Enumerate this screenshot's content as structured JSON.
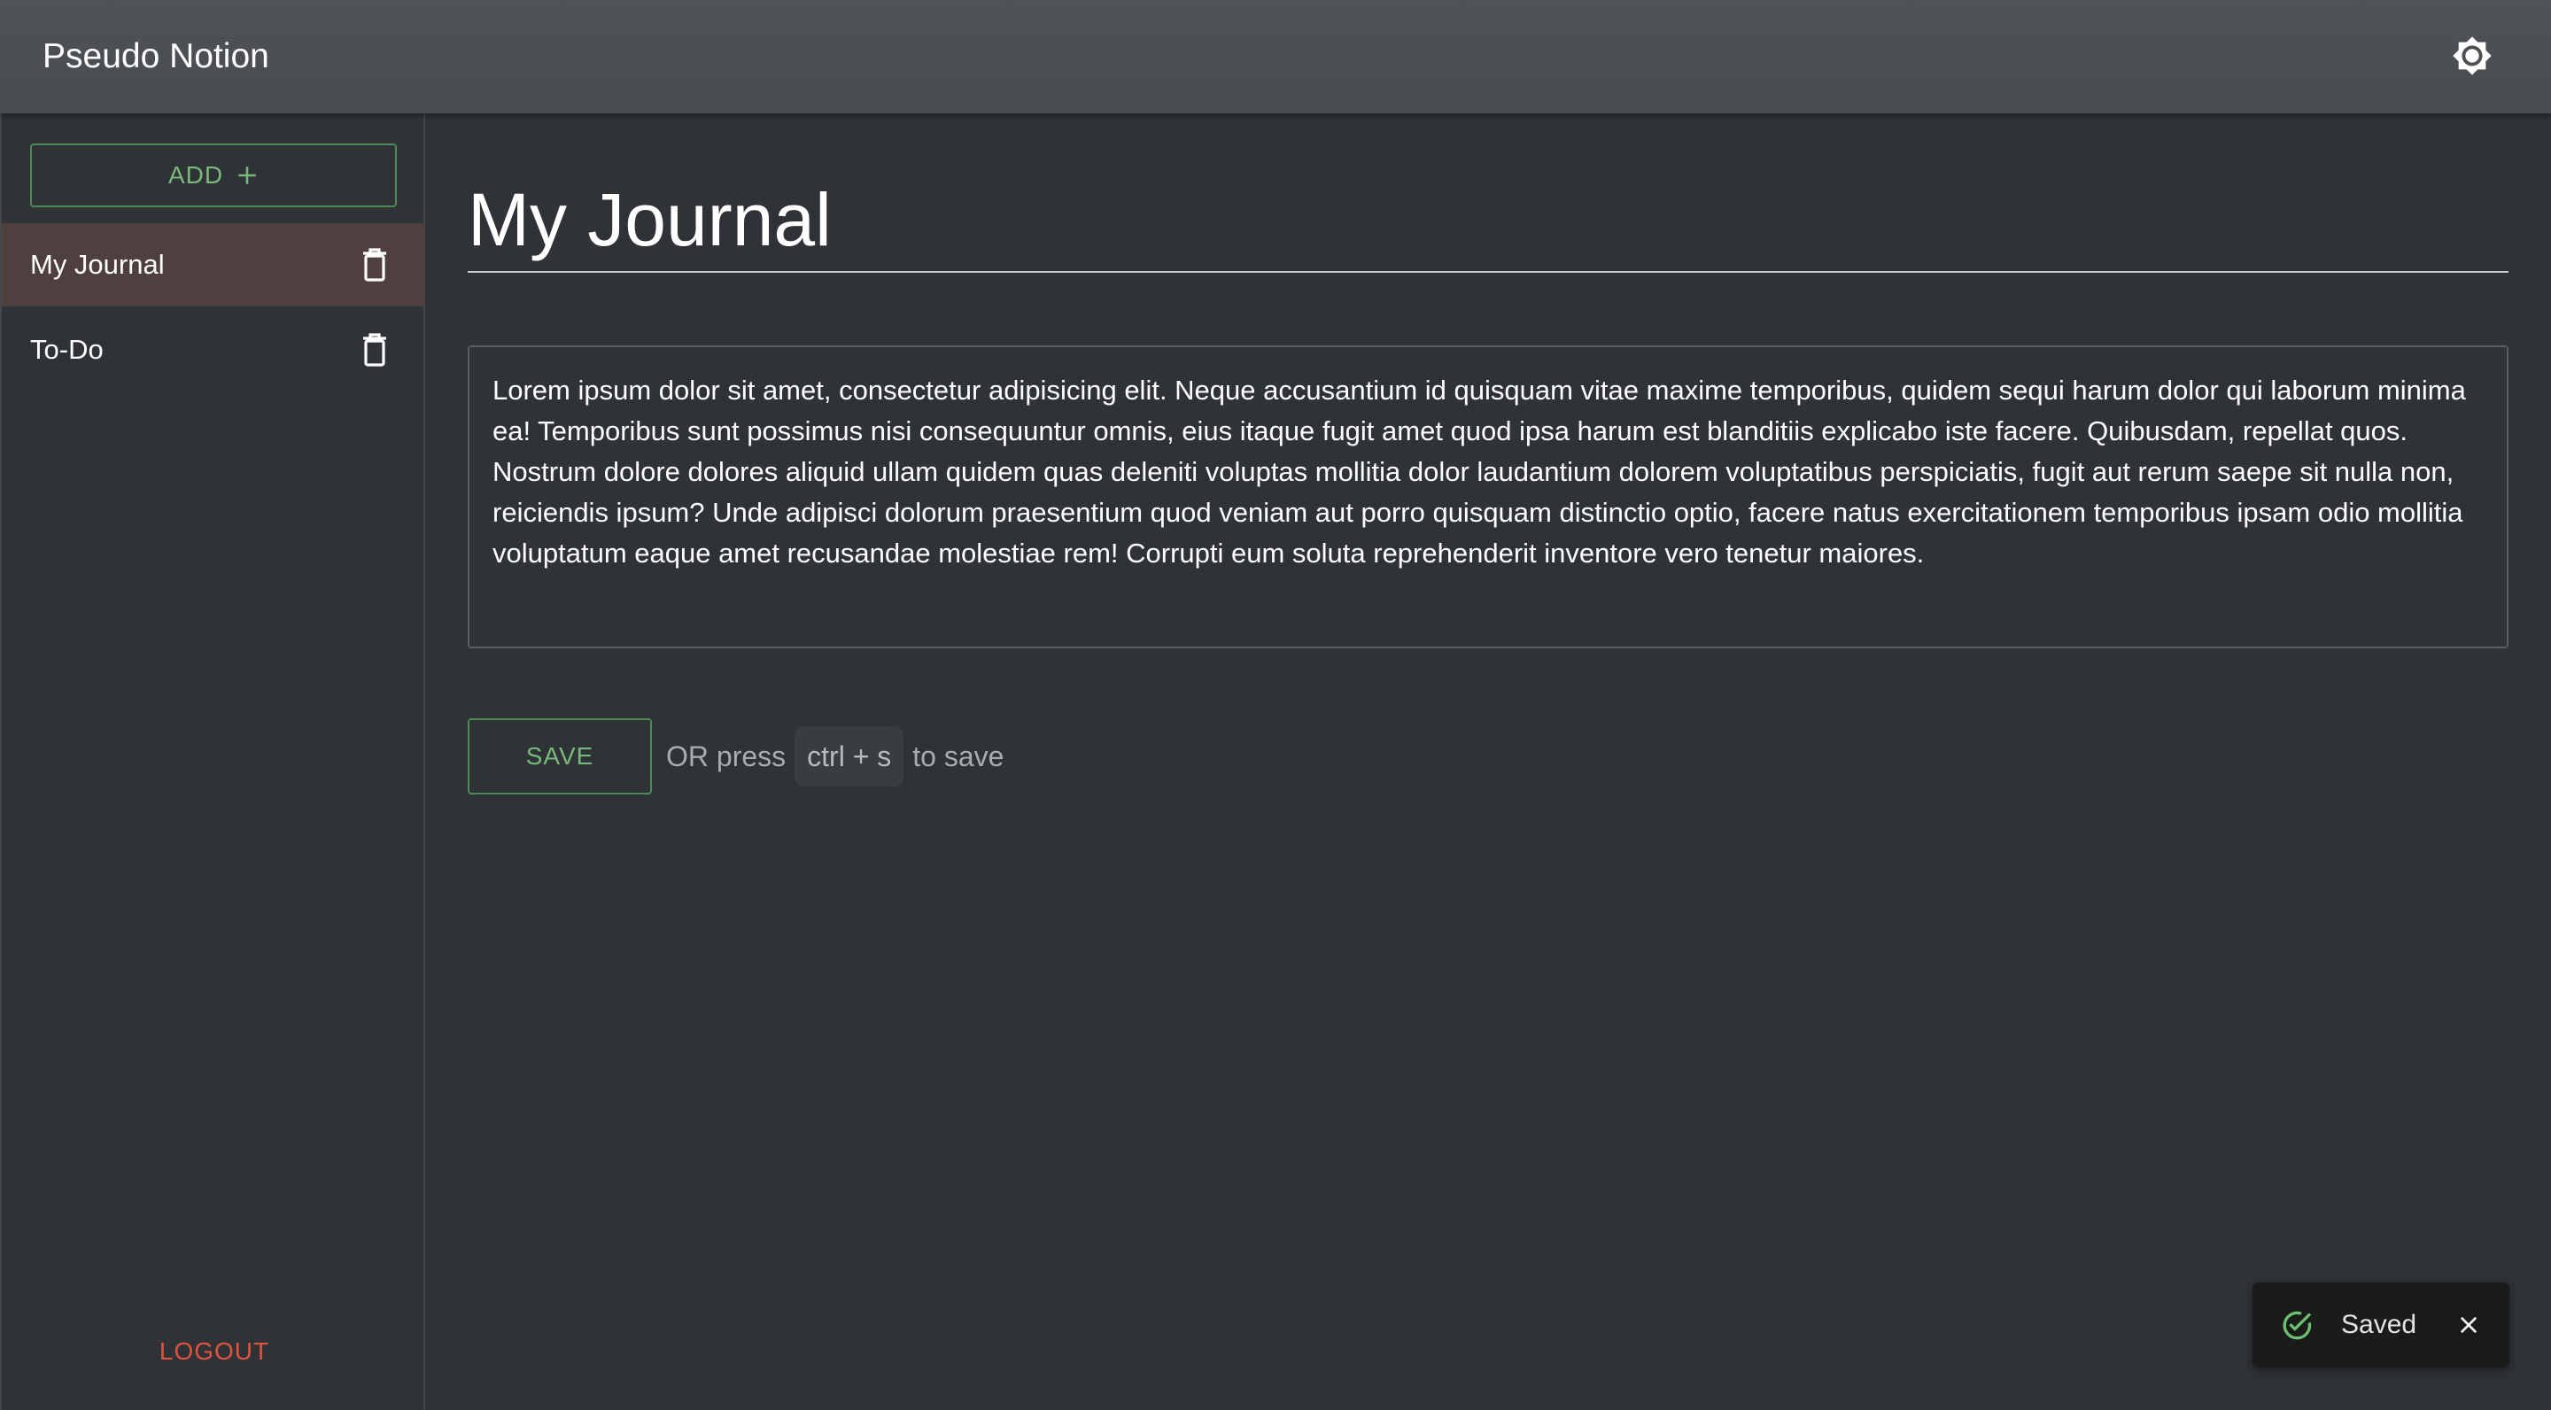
{
  "app": {
    "title": "Pseudo Notion"
  },
  "header": {
    "theme_toggle_icon": "brightness-icon"
  },
  "sidebar": {
    "add_label": "ADD",
    "add_icon": "plus-icon",
    "items": [
      {
        "label": "My Journal",
        "selected": true,
        "delete_icon": "trash-icon"
      },
      {
        "label": "To-Do",
        "selected": false,
        "delete_icon": "trash-icon"
      }
    ],
    "logout_label": "LOGOUT"
  },
  "main": {
    "title": "My Journal",
    "body": "Lorem ipsum dolor sit amet, consectetur adipisicing elit. Neque accusantium id quisquam vitae maxime temporibus, quidem sequi harum dolor qui laborum minima ea! Temporibus sunt possimus nisi consequuntur omnis, eius itaque fugit amet quod ipsa harum est blanditiis explicabo iste facere. Quibusdam, repellat quos. Nostrum dolore dolores aliquid ullam quidem quas deleniti voluptas mollitia dolor laudantium dolorem voluptatibus perspiciatis, fugit aut rerum saepe sit nulla non, reiciendis ipsum? Unde adipisci dolorum praesentium quod veniam aut porro quisquam distinctio optio, facere natus exercitationem temporibus ipsam odio mollitia voluptatum eaque amet recusandae molestiae rem! Corrupti eum soluta reprehenderit inventore vero tenetur maiores.",
    "save_label": "SAVE",
    "hint_prefix": "OR press",
    "shortcut": "ctrl + s",
    "hint_suffix": "to save"
  },
  "snackbar": {
    "message": "Saved",
    "status_icon": "check-circle-icon",
    "close_icon": "close-icon"
  },
  "colors": {
    "accent_green": "#78b97b",
    "logout_red": "#e0533f",
    "selected_item_bg": "#4f3f3f",
    "background": "#2f3236",
    "appbar": "#4c5054"
  }
}
